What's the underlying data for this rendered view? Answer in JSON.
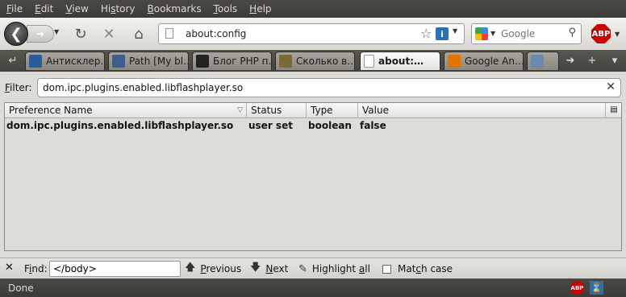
{
  "menu": [
    {
      "pre": "",
      "ul": "F",
      "post": "ile"
    },
    {
      "pre": "",
      "ul": "E",
      "post": "dit"
    },
    {
      "pre": "",
      "ul": "V",
      "post": "iew"
    },
    {
      "pre": "Hi",
      "ul": "s",
      "post": "tory"
    },
    {
      "pre": "",
      "ul": "B",
      "post": "ookmarks"
    },
    {
      "pre": "",
      "ul": "T",
      "post": "ools"
    },
    {
      "pre": "",
      "ul": "H",
      "post": "elp"
    }
  ],
  "nav": {
    "url": "about:config",
    "search_engine": "Google",
    "abp_label": "ABP"
  },
  "tabs": [
    {
      "title": "Антисклер…",
      "icon_color": "#2a5c9a"
    },
    {
      "title": "Path [My bl…",
      "icon_color": "#3b5f8a"
    },
    {
      "title": "Блог PHP п…",
      "icon_color": "#222222"
    },
    {
      "title": "Сколько в…",
      "icon_color": "#7a6a3a"
    },
    {
      "title": "about:…",
      "icon_color": "#ffffff"
    },
    {
      "title": "Google An…",
      "icon_color": "#e37400"
    },
    {
      "title": "",
      "icon_color": "#6a8ab0"
    }
  ],
  "filter": {
    "label_ul": "F",
    "label_rest": "ilter:",
    "value": "dom.ipc.plugins.enabled.libflashplayer.so"
  },
  "columns": [
    "Preference Name",
    "Status",
    "Type",
    "Value"
  ],
  "rows": [
    {
      "name": "dom.ipc.plugins.enabled.libflashplayer.so",
      "status": "user set",
      "type": "boolean",
      "value": "false"
    }
  ],
  "findbar": {
    "label_ul": "i",
    "label_pre": "F",
    "label_post": "nd:",
    "value": "</body>",
    "prev_ul": "P",
    "prev_rest": "revious",
    "next_ul": "N",
    "next_rest": "ext",
    "highlight_pre": "Highlight ",
    "highlight_ul": "a",
    "highlight_post": "ll",
    "match_pre": "Mat",
    "match_ul": "c",
    "match_post": "h case"
  },
  "status": {
    "text": "Done",
    "abp_label": "ABP"
  }
}
